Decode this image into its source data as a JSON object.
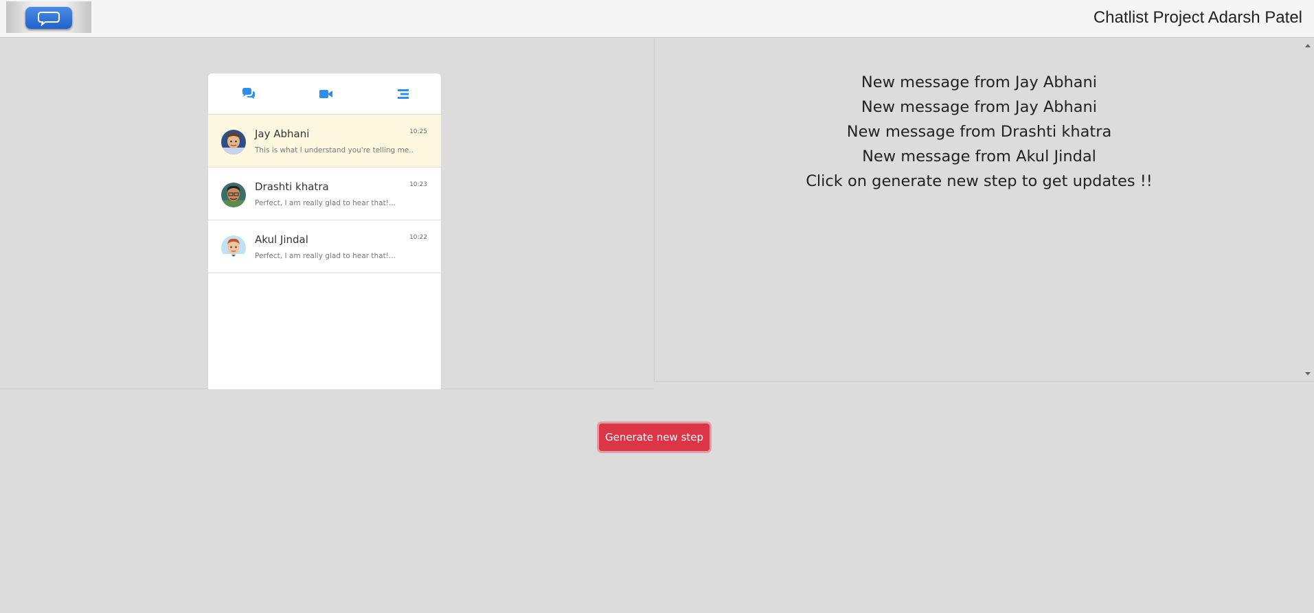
{
  "header": {
    "title": "Chatlist Project Adarsh Patel",
    "logo_icon": "chat-bubble-icon"
  },
  "tabs": [
    {
      "icon": "comments-icon"
    },
    {
      "icon": "video-icon"
    },
    {
      "icon": "menu-icon"
    }
  ],
  "chats": [
    {
      "name": "Jay Abhani",
      "time": "10:25",
      "preview": "This is what I understand you're telling me..",
      "active": true
    },
    {
      "name": "Drashti khatra",
      "time": "10:23",
      "preview": "Perfect, I am really glad to hear that!...",
      "active": false
    },
    {
      "name": "Akul Jindal",
      "time": "10:22",
      "preview": "Perfect, I am really glad to hear that!...",
      "active": false
    }
  ],
  "messages": [
    "New message from Jay Abhani",
    "New message from Jay Abhani",
    "New message from Drashti khatra",
    "New message from Akul Jindal",
    "Click on generate new step to get updates !!"
  ],
  "generate_button": "Generate new step",
  "colors": {
    "accent": "#2b8ef0",
    "button": "#dc3545",
    "active_row": "#fff8e1"
  }
}
